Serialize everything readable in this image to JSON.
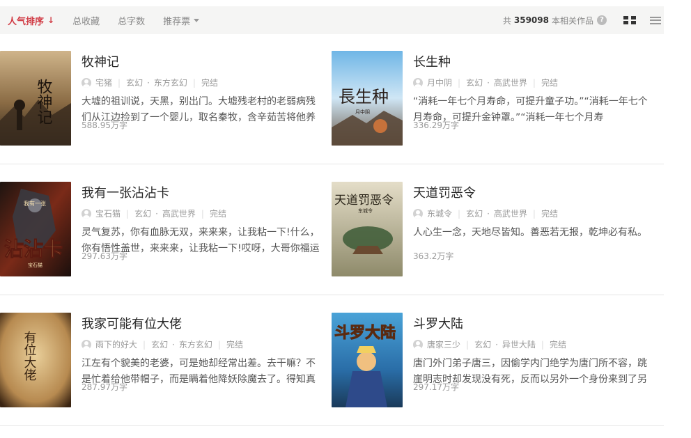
{
  "sort_tabs": [
    {
      "label": "人气排序",
      "active": true
    },
    {
      "label": "总收藏",
      "active": false
    },
    {
      "label": "总字数",
      "active": false
    },
    {
      "label": "推荐票",
      "active": false
    }
  ],
  "result_summary": {
    "prefix": "共",
    "count": "359098",
    "suffix": "本相关作品"
  },
  "colors": {
    "accent": "#d13c45",
    "toolbar_bg": "#f5f5f4"
  },
  "icons": {
    "sort": "arrow-down-icon",
    "help": "help-icon",
    "grid_view": "grid-view-icon",
    "list_view": "list-view-icon",
    "author": "avatar-icon"
  },
  "books": [
    {
      "title": "牧神记",
      "author": "宅猪",
      "category": "玄幻",
      "subcategory": "东方玄幻",
      "status": "完结",
      "intro": "大墟的祖训说，天黑，别出门。大墟残老村的老弱病残们从江边捡到了一个婴儿，取名秦牧，含辛茹苦将他养",
      "words": "588.95万字",
      "cover_text": "牧神记"
    },
    {
      "title": "长生种",
      "author": "月中阴",
      "category": "玄幻",
      "subcategory": "高武世界",
      "status": "完结",
      "intro": "“消耗一年七个月寿命，可提升童子功。”“消耗一年七个月寿命，可提升金钟罩。”“消耗一年七个月寿",
      "words": "336.29万字",
      "cover_text": "長生种",
      "cover_sub": "月中阴"
    },
    {
      "title": "我有一张沾沾卡",
      "author": "宝石猫",
      "category": "玄幻",
      "subcategory": "高武世界",
      "status": "完结",
      "intro": "灵气复苏，你有血脉无双，来来来，让我粘一下!什么，你有悟性盖世，来来来，让我粘一下!哎呀，大哥你福运",
      "words": "297.63万字",
      "cover_text": "沾沾卡",
      "cover_top": "我有一张",
      "cover_sub": "宝石猫"
    },
    {
      "title": "天道罚恶令",
      "author": "东城令",
      "category": "玄幻",
      "subcategory": "高武世界",
      "status": "完结",
      "intro": "人心生一念，天地尽皆知。善恶若无报，乾坤必有私。",
      "words": "363.2万字",
      "cover_text": "天道罚恶令",
      "cover_sub": "东城令"
    },
    {
      "title": "我家可能有位大佬",
      "author": "雨下的好大",
      "category": "玄幻",
      "subcategory": "东方玄幻",
      "status": "完结",
      "intro": "江左有个貌美的老婆，可是她却经常出差。去干嘛？不是忙着给他带帽子，而是瞒着他降妖除魔去了。得知真",
      "words": "287.97万字",
      "cover_text": "有位大佬"
    },
    {
      "title": "斗罗大陆",
      "author": "唐家三少",
      "category": "玄幻",
      "subcategory": "异世大陆",
      "status": "完结",
      "intro": "唐门外门弟子唐三，因偷学内门绝学为唐门所不容，跳崖明志时却发现没有死，反而以另外一个身份来到了另",
      "words": "297.17万字",
      "cover_text": "斗罗大陆"
    }
  ]
}
